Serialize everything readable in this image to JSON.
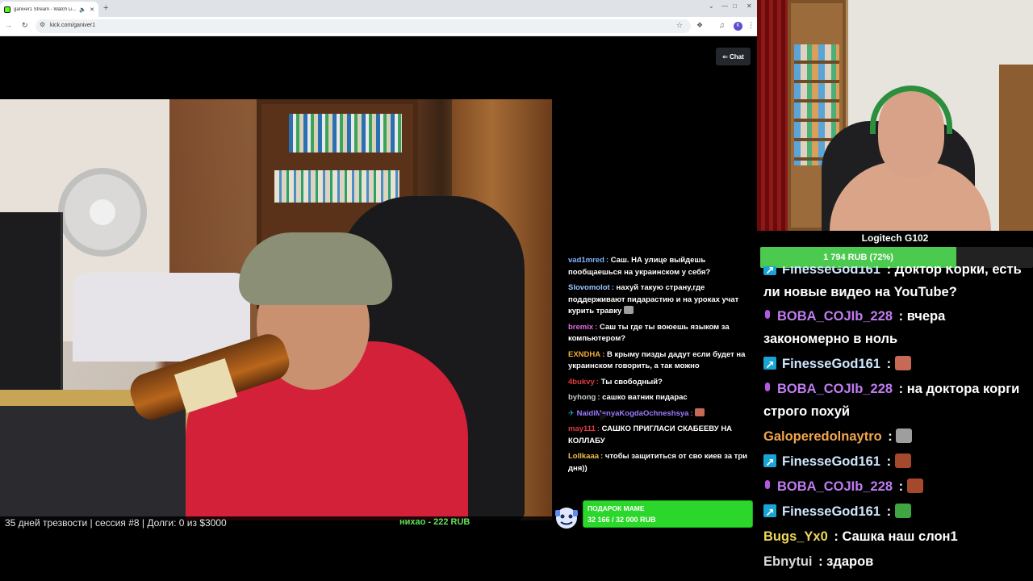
{
  "browser": {
    "tab_title": "ganiver1 Stream - Watch Li...",
    "url": "kick.com/ganiver1",
    "profile_initial": "K"
  },
  "player": {
    "chat_button_label": "Chat"
  },
  "ticker": {
    "left": "35 дней  трезвости | сессия #8  | Долги: 0 из $3000",
    "mid": "нихао - 222 RUB"
  },
  "overlay_chat": [
    {
      "user": "vad1mred",
      "color": "#7fb4ff",
      "text": "Саш. НА улице выйдешь пообщаешься на украинском у себя?",
      "emote": null
    },
    {
      "user": "Slovomolot",
      "color": "#9ac6ff",
      "text": "нахуй такую страну,где поддерживают пидарастию и на уроках учат курить травку",
      "emote": "cat"
    },
    {
      "user": "bremix",
      "color": "#e06be0",
      "text": "Саш ты где ты воюешь языком за компьютером?",
      "emote": null
    },
    {
      "user": "EXNDHA",
      "color": "#f2a93b",
      "text": "В крыму пизды дадут если будет на украинском говорить, а так можно",
      "emote": null
    },
    {
      "user": "4bukvy",
      "color": "#e03b3b",
      "text": "Ты свободный?",
      "emote": null
    },
    {
      "user": "byhong",
      "color": "#c9c9c9",
      "text": "сашко ватник пидарас",
      "emote": null
    },
    {
      "user": "NaidiMenyaKogdaOchneshsya",
      "color": "#9b7bff",
      "text": "",
      "emote": "face",
      "prime": true
    },
    {
      "user": "may111",
      "color": "#e03b3b",
      "text": "САШКО ПРИГЛАСИ СКАБЕЕВУ НА КОЛЛАБУ",
      "emote": null
    },
    {
      "user": "Lollkaaa",
      "color": "#f0c24a",
      "text": "чтобы защититься от сво киев за три дня))",
      "emote": null
    }
  ],
  "gift_goal": {
    "title": "ПОДАРОК МАМЕ",
    "value": "32 166 / 32 000 RUB"
  },
  "right_panel": {
    "cam_label": "Logitech G102",
    "goal_text": "1 794 RUB (72%)",
    "goal_percent": 72
  },
  "big_chat": [
    {
      "user": "FinesseGod161",
      "color": "#cfe7ff",
      "badge": "prime",
      "text": "Доктор Корки, есть ли новые видео на YouTube?",
      "emote": null
    },
    {
      "user": "BOBA_COJIb_228",
      "color": "#c07cf0",
      "badge": "mic",
      "text": "вчера закономерно в ноль",
      "emote": null
    },
    {
      "user": "FinesseGod161",
      "color": "#cfe7ff",
      "badge": "prime",
      "text": "",
      "emote": "face"
    },
    {
      "user": "BOBA_COJIb_228",
      "color": "#c07cf0",
      "badge": "mic",
      "text": "на доктора корги строго похуй",
      "emote": null
    },
    {
      "user": "Galoperedolnaytro",
      "color": "#f3a64a",
      "badge": null,
      "text": "",
      "emote": "cat"
    },
    {
      "user": "FinesseGod161",
      "color": "#cfe7ff",
      "badge": "prime",
      "text": "",
      "emote": "brick"
    },
    {
      "user": "BOBA_COJIb_228",
      "color": "#c07cf0",
      "badge": "mic",
      "text": "",
      "emote": "brick"
    },
    {
      "user": "FinesseGod161",
      "color": "#cfe7ff",
      "badge": "prime",
      "text": "",
      "emote": "pepe"
    },
    {
      "user": "Bugs_Yx0",
      "color": "#f0d65a",
      "badge": null,
      "text": "Сашка наш слон1",
      "emote": null
    },
    {
      "user": "Ebnytui",
      "color": "#d8d8d8",
      "badge": null,
      "text": "здаров",
      "emote": null
    }
  ],
  "emote_colors": {
    "cat": "#9e9e9e",
    "face": "#c76a55",
    "brick": "#a5492c",
    "pepe": "#3fa540"
  }
}
